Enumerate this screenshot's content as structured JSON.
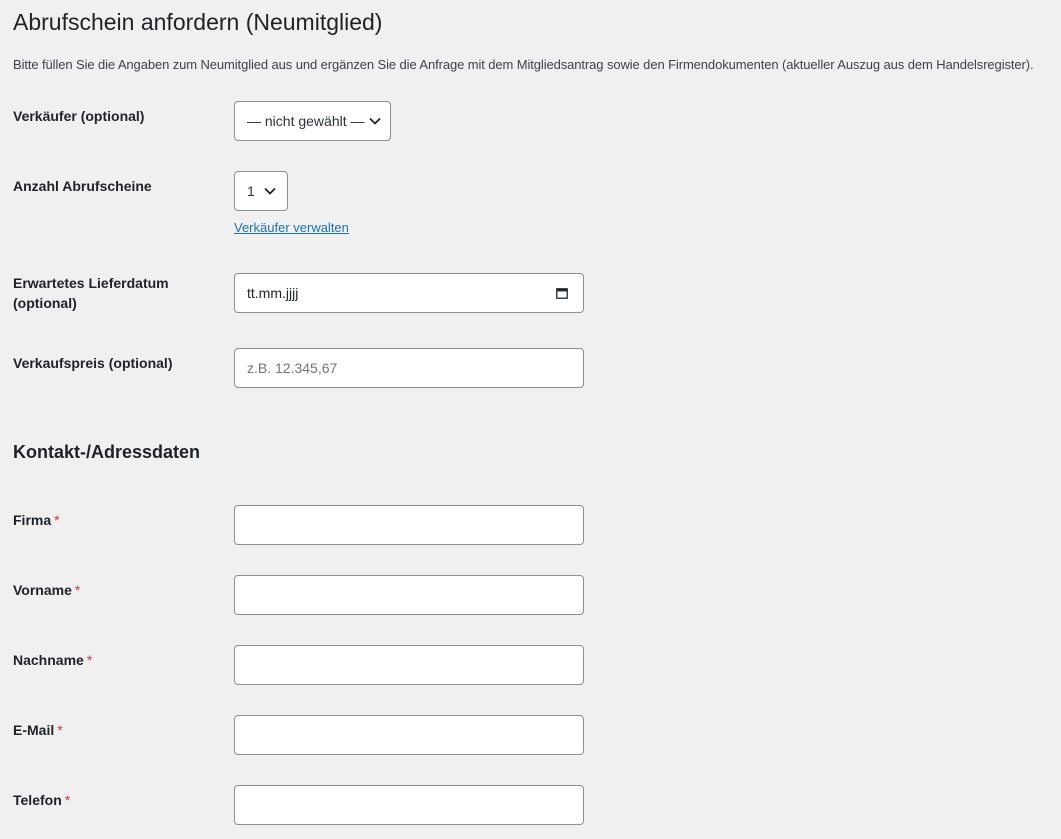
{
  "page": {
    "title": "Abrufschein anfordern (Neumitglied)",
    "intro": "Bitte füllen Sie die Angaben zum Neumitglied aus und ergänzen Sie die Anfrage mit dem Mitgliedsantrag sowie den Firmendokumenten (aktueller Auszug aus dem Handelsregister)."
  },
  "form": {
    "seller": {
      "label": "Verkäufer (optional)",
      "value": "— nicht gewählt —"
    },
    "count": {
      "label": "Anzahl Abrufscheine",
      "value": "1"
    },
    "manage_sellers_link": "Verkäufer verwalten",
    "delivery_date": {
      "label_line1": "Erwartetes Lieferdatum",
      "label_line2": "(optional)",
      "placeholder": "tt.mm.jjjj"
    },
    "price": {
      "label": "Verkaufspreis (optional)",
      "placeholder": "z.B. 12.345,67"
    }
  },
  "contact": {
    "heading": "Kontakt-/Adressdaten",
    "required_marker": "*",
    "fields": [
      {
        "label": "Firma",
        "value": ""
      },
      {
        "label": "Vorname",
        "value": ""
      },
      {
        "label": "Nachname",
        "value": ""
      },
      {
        "label": "E-Mail",
        "value": ""
      },
      {
        "label": "Telefon",
        "value": ""
      }
    ]
  },
  "colors": {
    "background": "#f0f0f1",
    "required": "#d63638",
    "link": "#2271b1",
    "border": "#8c8f94"
  }
}
